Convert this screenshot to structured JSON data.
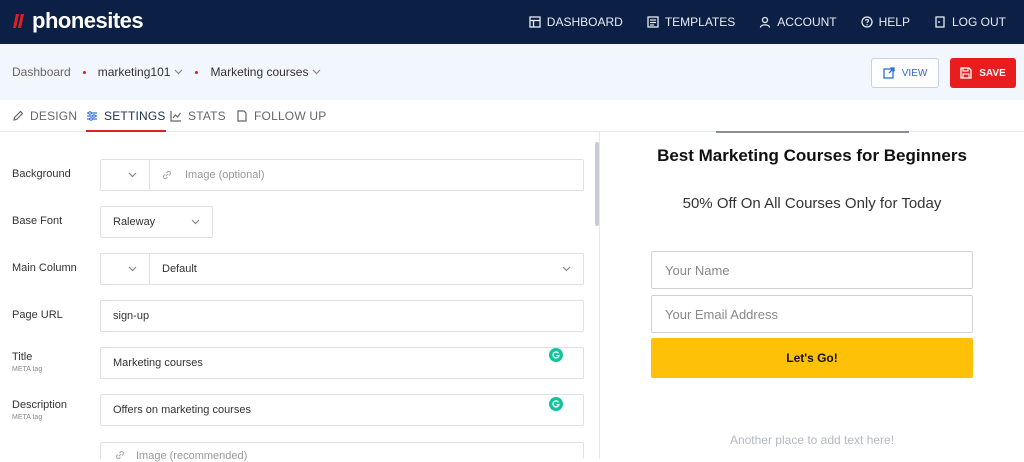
{
  "app": {
    "logo_text": "phonesites",
    "brand_color": "#e02020",
    "nav_bg": "#0c1f45"
  },
  "topnav": [
    {
      "label": "DASHBOARD",
      "icon": "dashboard-icon"
    },
    {
      "label": "TEMPLATES",
      "icon": "templates-icon"
    },
    {
      "label": "ACCOUNT",
      "icon": "account-icon"
    },
    {
      "label": "HELP",
      "icon": "help-icon"
    },
    {
      "label": "LOG OUT",
      "icon": "logout-icon"
    }
  ],
  "breadcrumb": [
    "Dashboard",
    "marketing101",
    "Marketing courses"
  ],
  "actions": {
    "view_label": "VIEW",
    "save_label": "SAVE"
  },
  "tabs": [
    {
      "label": "DESIGN",
      "icon": "pencil-icon",
      "active": false
    },
    {
      "label": "SETTINGS",
      "icon": "sliders-icon",
      "active": true
    },
    {
      "label": "STATS",
      "icon": "chart-icon",
      "active": false
    },
    {
      "label": "FOLLOW UP",
      "icon": "document-icon",
      "active": false
    }
  ],
  "settings": {
    "background": {
      "label": "Background",
      "image_placeholder": "Image (optional)"
    },
    "base_font": {
      "label": "Base Font",
      "value": "Raleway"
    },
    "main_column": {
      "label": "Main Column",
      "value": "Default"
    },
    "page_url": {
      "label": "Page URL",
      "value": "sign-up"
    },
    "title": {
      "label": "Title",
      "sublabel": "META tag",
      "value": "Marketing courses"
    },
    "description": {
      "label": "Description",
      "sublabel": "META tag",
      "value": "Offers on marketing courses"
    },
    "image": {
      "placeholder": "Image (recommended)"
    }
  },
  "preview": {
    "headline": "Best Marketing Courses for Beginners",
    "subheadline": "50% Off On All Courses Only for Today",
    "name_placeholder": "Your Name",
    "email_placeholder": "Your Email Address",
    "cta_label": "Let's Go!",
    "cta_color": "#ffc107",
    "footer_text": "Another place to add text here!"
  }
}
